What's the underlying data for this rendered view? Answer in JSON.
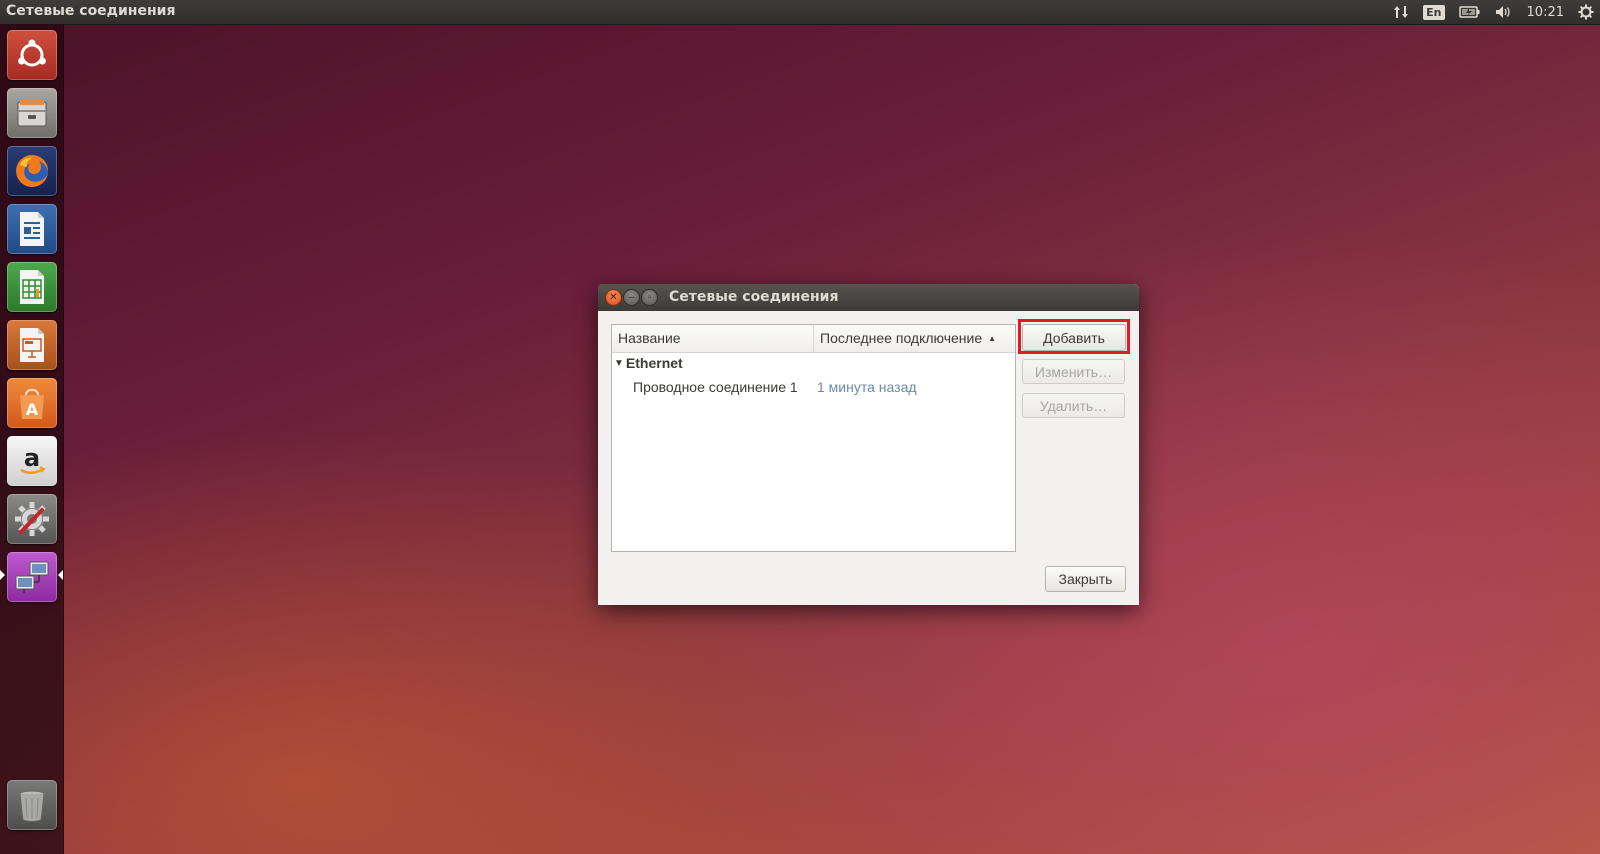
{
  "top_panel": {
    "app_title": "Сетевые соединения",
    "language": "En",
    "clock": "10:21",
    "icons": [
      "network-updown-icon",
      "language-indicator",
      "battery-icon",
      "volume-icon",
      "gear-icon"
    ]
  },
  "launcher": {
    "items": [
      {
        "name": "ubuntu-dash-icon",
        "color": "#c0392b"
      },
      {
        "name": "files-icon",
        "color": "#8a8a86"
      },
      {
        "name": "firefox-icon",
        "color": "#e66000"
      },
      {
        "name": "libreoffice-writer-icon",
        "color": "#2a5f9e"
      },
      {
        "name": "libreoffice-calc-icon",
        "color": "#2f8f2f"
      },
      {
        "name": "libreoffice-impress-icon",
        "color": "#c85a1e"
      },
      {
        "name": "ubuntu-software-center-icon",
        "color": "#e96b25"
      },
      {
        "name": "amazon-icon",
        "color": "#f2f2f2"
      },
      {
        "name": "system-settings-icon",
        "color": "#6a6a6a"
      },
      {
        "name": "network-connections-icon",
        "color": "#a03cb0"
      },
      {
        "name": "trash-icon",
        "color": "#777"
      }
    ]
  },
  "dialog": {
    "title": "Сетевые соединения",
    "columns": {
      "name": "Название",
      "last_connection": "Последнее подключение"
    },
    "groups": [
      {
        "label": "Ethernet",
        "connections": [
          {
            "name": "Проводное соединение 1",
            "last": "1 минута назад"
          }
        ]
      }
    ],
    "buttons": {
      "add": "Добавить",
      "edit": "Изменить…",
      "delete": "Удалить…",
      "close": "Закрыть"
    },
    "highlight_color": "#e01b24"
  }
}
